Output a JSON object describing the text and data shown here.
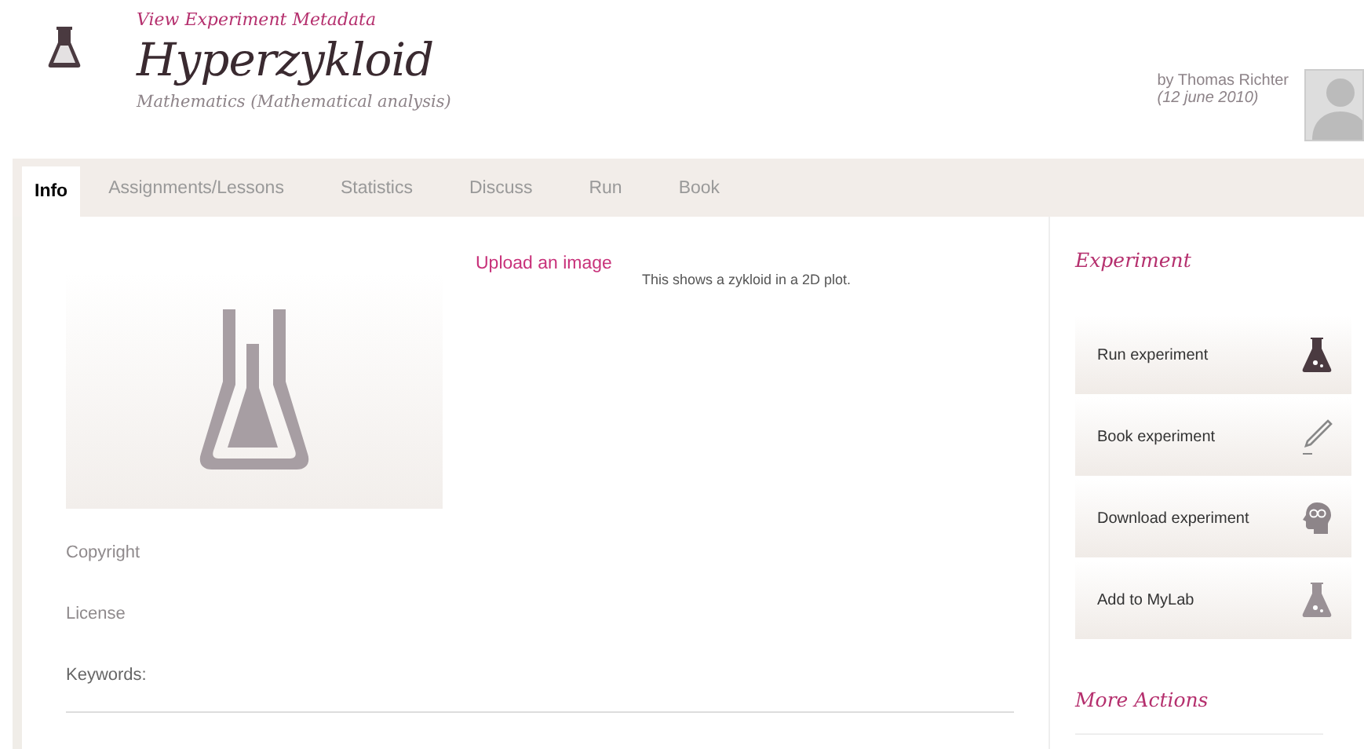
{
  "header": {
    "metadata_link": "View Experiment Metadata",
    "title": "Hyperzykloid",
    "subject": "Mathematics (Mathematical analysis)",
    "author": "by Thomas Richter",
    "date": "(12 june 2010)"
  },
  "tabs": [
    {
      "label": "Info",
      "selected": true
    },
    {
      "label": "Assignments/Lessons",
      "selected": false
    },
    {
      "label": "Statistics",
      "selected": false
    },
    {
      "label": "Discuss",
      "selected": false
    },
    {
      "label": "Run",
      "selected": false
    },
    {
      "label": "Book",
      "selected": false
    }
  ],
  "main": {
    "upload_link": "Upload an image",
    "description": "This shows a zykloid in a 2D plot.",
    "fields": [
      "Copyright",
      "License",
      "Keywords:"
    ]
  },
  "sidebar": {
    "heading": "Experiment",
    "actions": [
      "Run experiment",
      "Book experiment",
      "Download experiment",
      "Add to MyLab"
    ],
    "more_heading": "More Actions"
  }
}
